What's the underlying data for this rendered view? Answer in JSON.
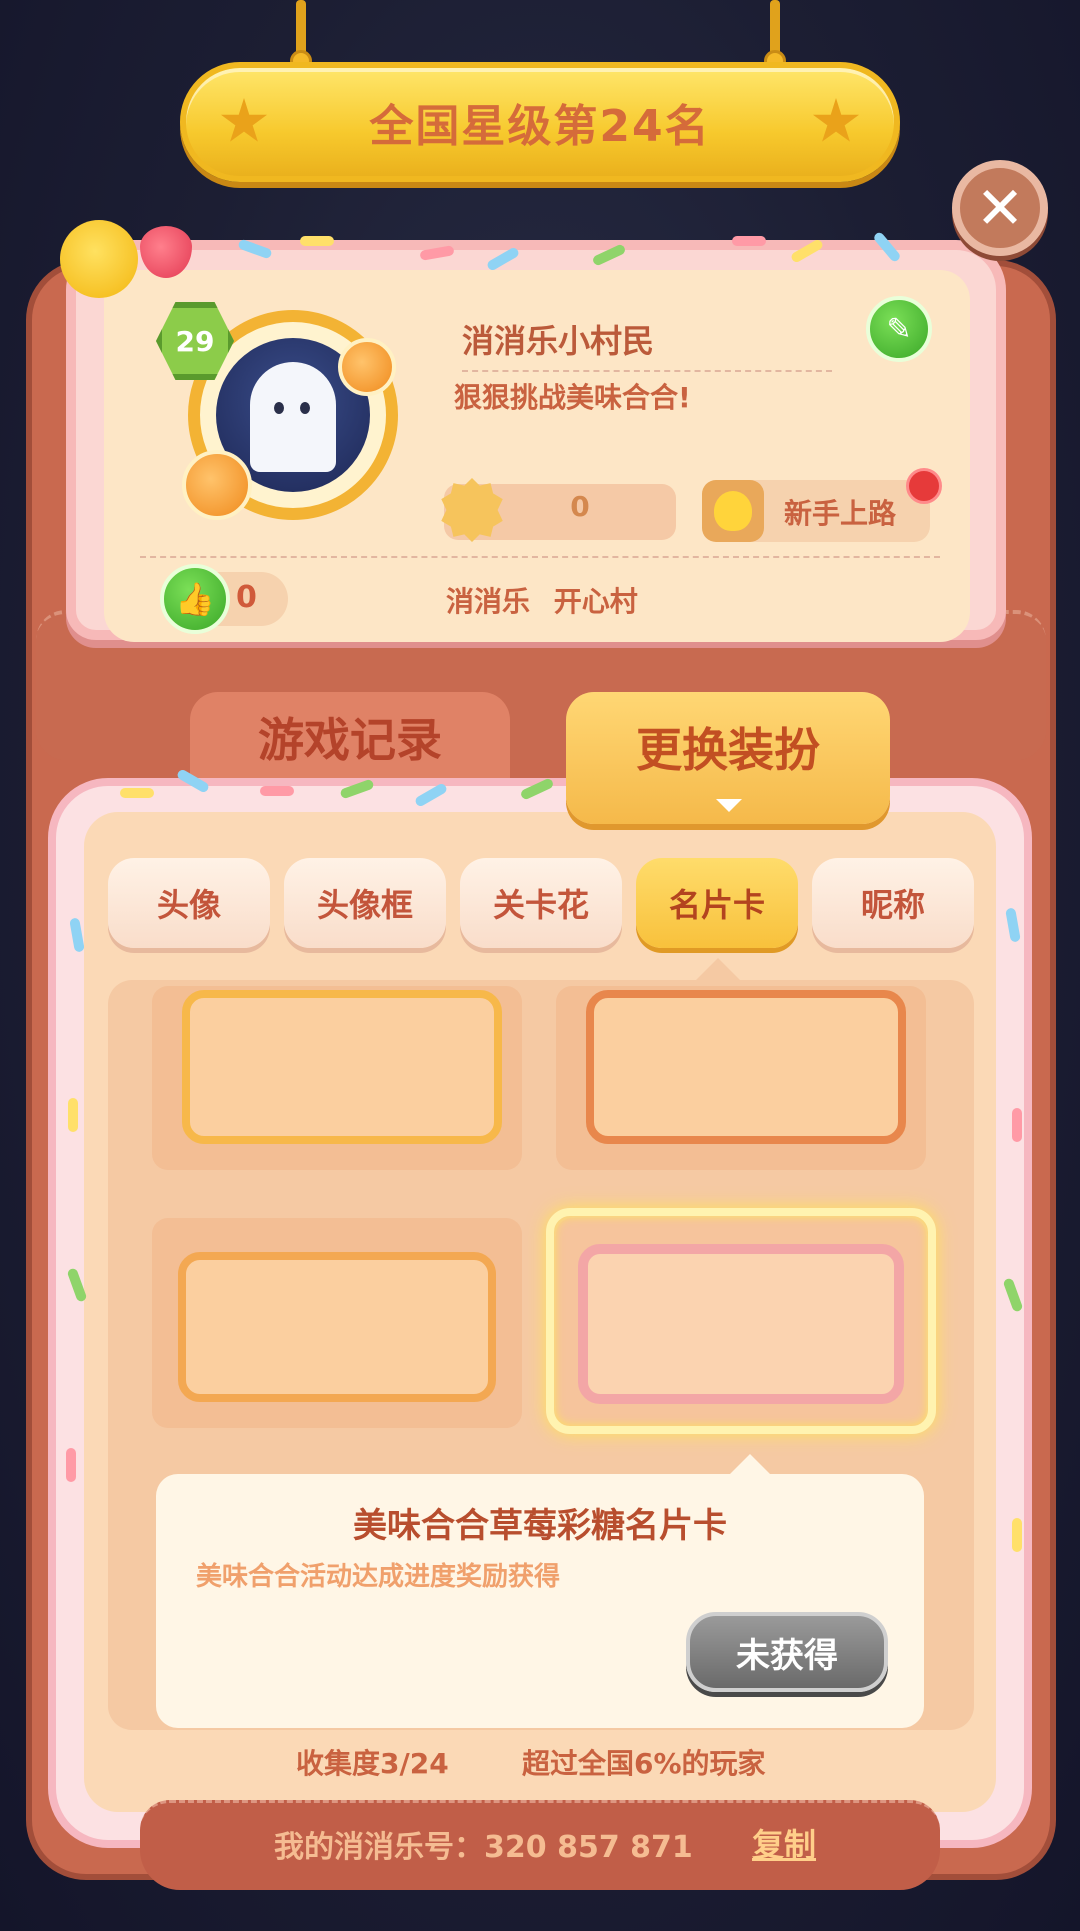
{
  "banner": {
    "rank_text": "全国星级第24名"
  },
  "close": {
    "icon": "close-icon"
  },
  "profile": {
    "level": "29",
    "nickname": "消消乐小村民",
    "slogan": "狠狠挑战美味合合!",
    "coins": "0",
    "title_badge": "新手上路",
    "likes": "0",
    "location": "消消乐 开心村",
    "avatar_icon": "ghost-avatar-icon",
    "edit_icon": "pencil-icon",
    "like_icon": "thumbs-up-icon",
    "coin_icon": "sun-coin-icon"
  },
  "main_tabs": [
    {
      "label": "游戏记录",
      "active": false
    },
    {
      "label": "更换装扮",
      "active": true
    }
  ],
  "sub_tabs": [
    {
      "label": "头像",
      "active": false
    },
    {
      "label": "头像框",
      "active": false
    },
    {
      "label": "关卡花",
      "active": false
    },
    {
      "label": "名片卡",
      "active": true
    },
    {
      "label": "昵称",
      "active": false
    }
  ],
  "cards": [
    {
      "name": "orange-card-1",
      "selected": false
    },
    {
      "name": "orange-card-2",
      "selected": false
    },
    {
      "name": "orange-card-3",
      "selected": false
    },
    {
      "name": "strawberry-candy-card",
      "selected": true
    }
  ],
  "info": {
    "title": "美味合合草莓彩糖名片卡",
    "description": "美味合合活动达成进度奖励获得",
    "button": "未获得"
  },
  "stats": {
    "collection": "收集度3/24",
    "exceed": "超过全国6%的玩家"
  },
  "footer": {
    "player_id": "我的消消乐号：320 857 871",
    "copy": "复制"
  },
  "colors": {
    "board": "#c9694f",
    "banner": "#f7c92d",
    "active_tab": "#f8c13c",
    "text_brown": "#c96240",
    "pink_frame": "#f6b7c0"
  }
}
